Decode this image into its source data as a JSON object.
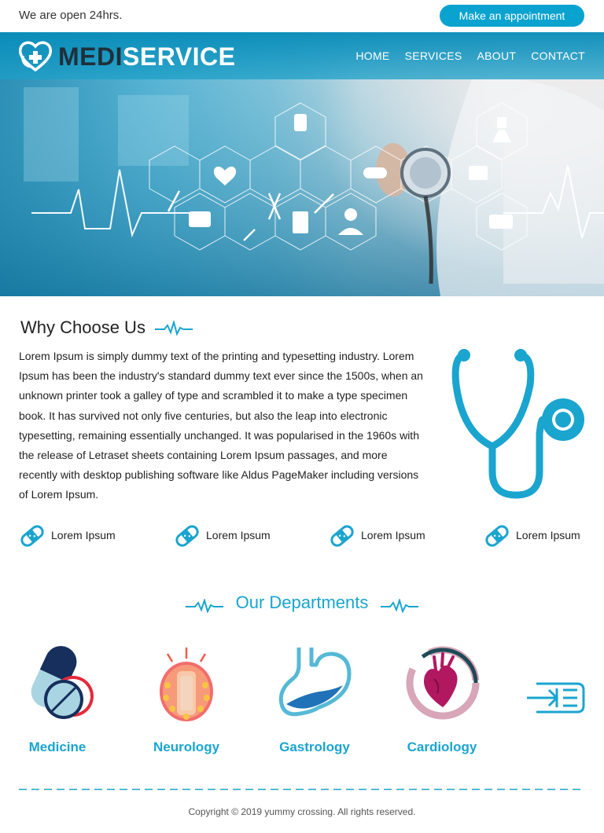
{
  "topbar": {
    "open_text": "We are open 24hrs.",
    "appointment_label": "Make an appointment"
  },
  "brand": {
    "part1": "MEDI",
    "part2": "SERVICE"
  },
  "nav": {
    "items": [
      "HOME",
      "SERVICES",
      "ABOUT",
      "CONTACT"
    ]
  },
  "why": {
    "title": "Why Choose Us",
    "text": "Lorem Ipsum is simply dummy text of the printing and typesetting industry. Lorem Ipsum has been the industry's standard dummy text ever since the 1500s, when an unknown printer took a galley of type and scrambled it to make a type specimen book. It has survived not only five centuries, but also the leap into electronic typesetting, remaining essentially unchanged. It was popularised in the 1960s with the release of Letraset sheets containing Lorem Ipsum passages, and more recently with desktop publishing software like Aldus PageMaker including versions of Lorem Ipsum.",
    "features": [
      "Lorem Ipsum",
      "Lorem Ipsum",
      "Lorem Ipsum",
      "Lorem Ipsum"
    ]
  },
  "departments": {
    "title": "Our Departments",
    "items": [
      {
        "label": "Medicine",
        "icon": "pills-icon"
      },
      {
        "label": "Neurology",
        "icon": "brain-icon"
      },
      {
        "label": "Gastrology",
        "icon": "stomach-icon"
      },
      {
        "label": "Cardiology",
        "icon": "heart-icon"
      }
    ],
    "next_icon": "arrow-right-icon"
  },
  "footer": {
    "copyright": "Copyright © 2019 yummy crossing. All rights reserved."
  },
  "colors": {
    "accent": "#1aa5cf",
    "button": "#0aa3cf",
    "brand_dark": "#1f2f3a"
  }
}
